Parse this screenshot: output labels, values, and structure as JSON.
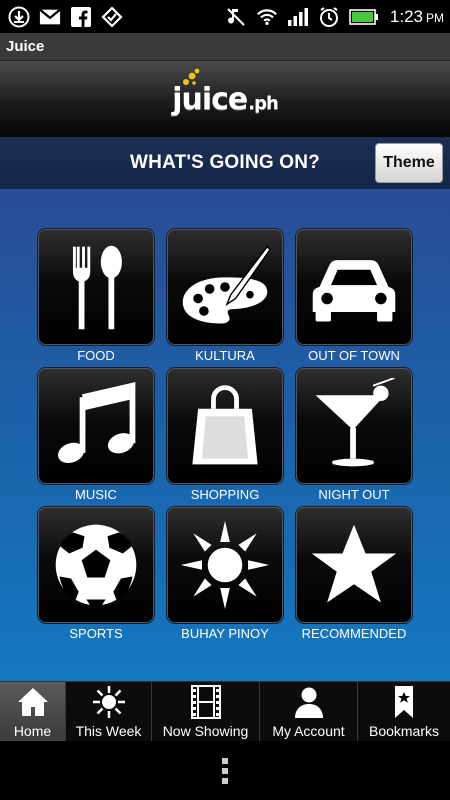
{
  "status_bar": {
    "time": "1:23",
    "ampm": "PM",
    "icons": [
      "download-icon",
      "gmail-icon",
      "facebook-icon",
      "foursquare-icon",
      "mute-icon",
      "wifi-icon",
      "signal-icon",
      "alarm-icon",
      "battery-icon"
    ]
  },
  "app": {
    "title": "Juice"
  },
  "logo": {
    "text": "juice",
    "tld": ".ph"
  },
  "header": {
    "title": "WHAT'S GOING ON?",
    "theme_label": "Theme"
  },
  "categories": [
    {
      "label": "FOOD",
      "icon": "fork-spoon-icon"
    },
    {
      "label": "KULTURA",
      "icon": "paint-palette-icon"
    },
    {
      "label": "OUT OF TOWN",
      "icon": "car-icon"
    },
    {
      "label": "MUSIC",
      "icon": "music-note-icon"
    },
    {
      "label": "SHOPPING",
      "icon": "shopping-bag-icon"
    },
    {
      "label": "NIGHT OUT",
      "icon": "cocktail-icon"
    },
    {
      "label": "SPORTS",
      "icon": "soccer-ball-icon"
    },
    {
      "label": "BUHAY PINOY",
      "icon": "philippine-sun-icon"
    },
    {
      "label": "RECOMMENDED",
      "icon": "star-icon"
    }
  ],
  "tabs": [
    {
      "label": "Home",
      "icon": "home-icon",
      "active": true
    },
    {
      "label": "This Week",
      "icon": "sun-icon",
      "active": false
    },
    {
      "label": "Now Showing",
      "icon": "film-icon",
      "active": false
    },
    {
      "label": "My Account",
      "icon": "person-icon",
      "active": false
    },
    {
      "label": "Bookmarks",
      "icon": "bookmark-icon",
      "active": false
    }
  ],
  "colors": {
    "header_bg": "#1b2f55",
    "main_top": "#2a4d94",
    "main_bottom": "#1478c0",
    "battery": "#47c93b"
  }
}
